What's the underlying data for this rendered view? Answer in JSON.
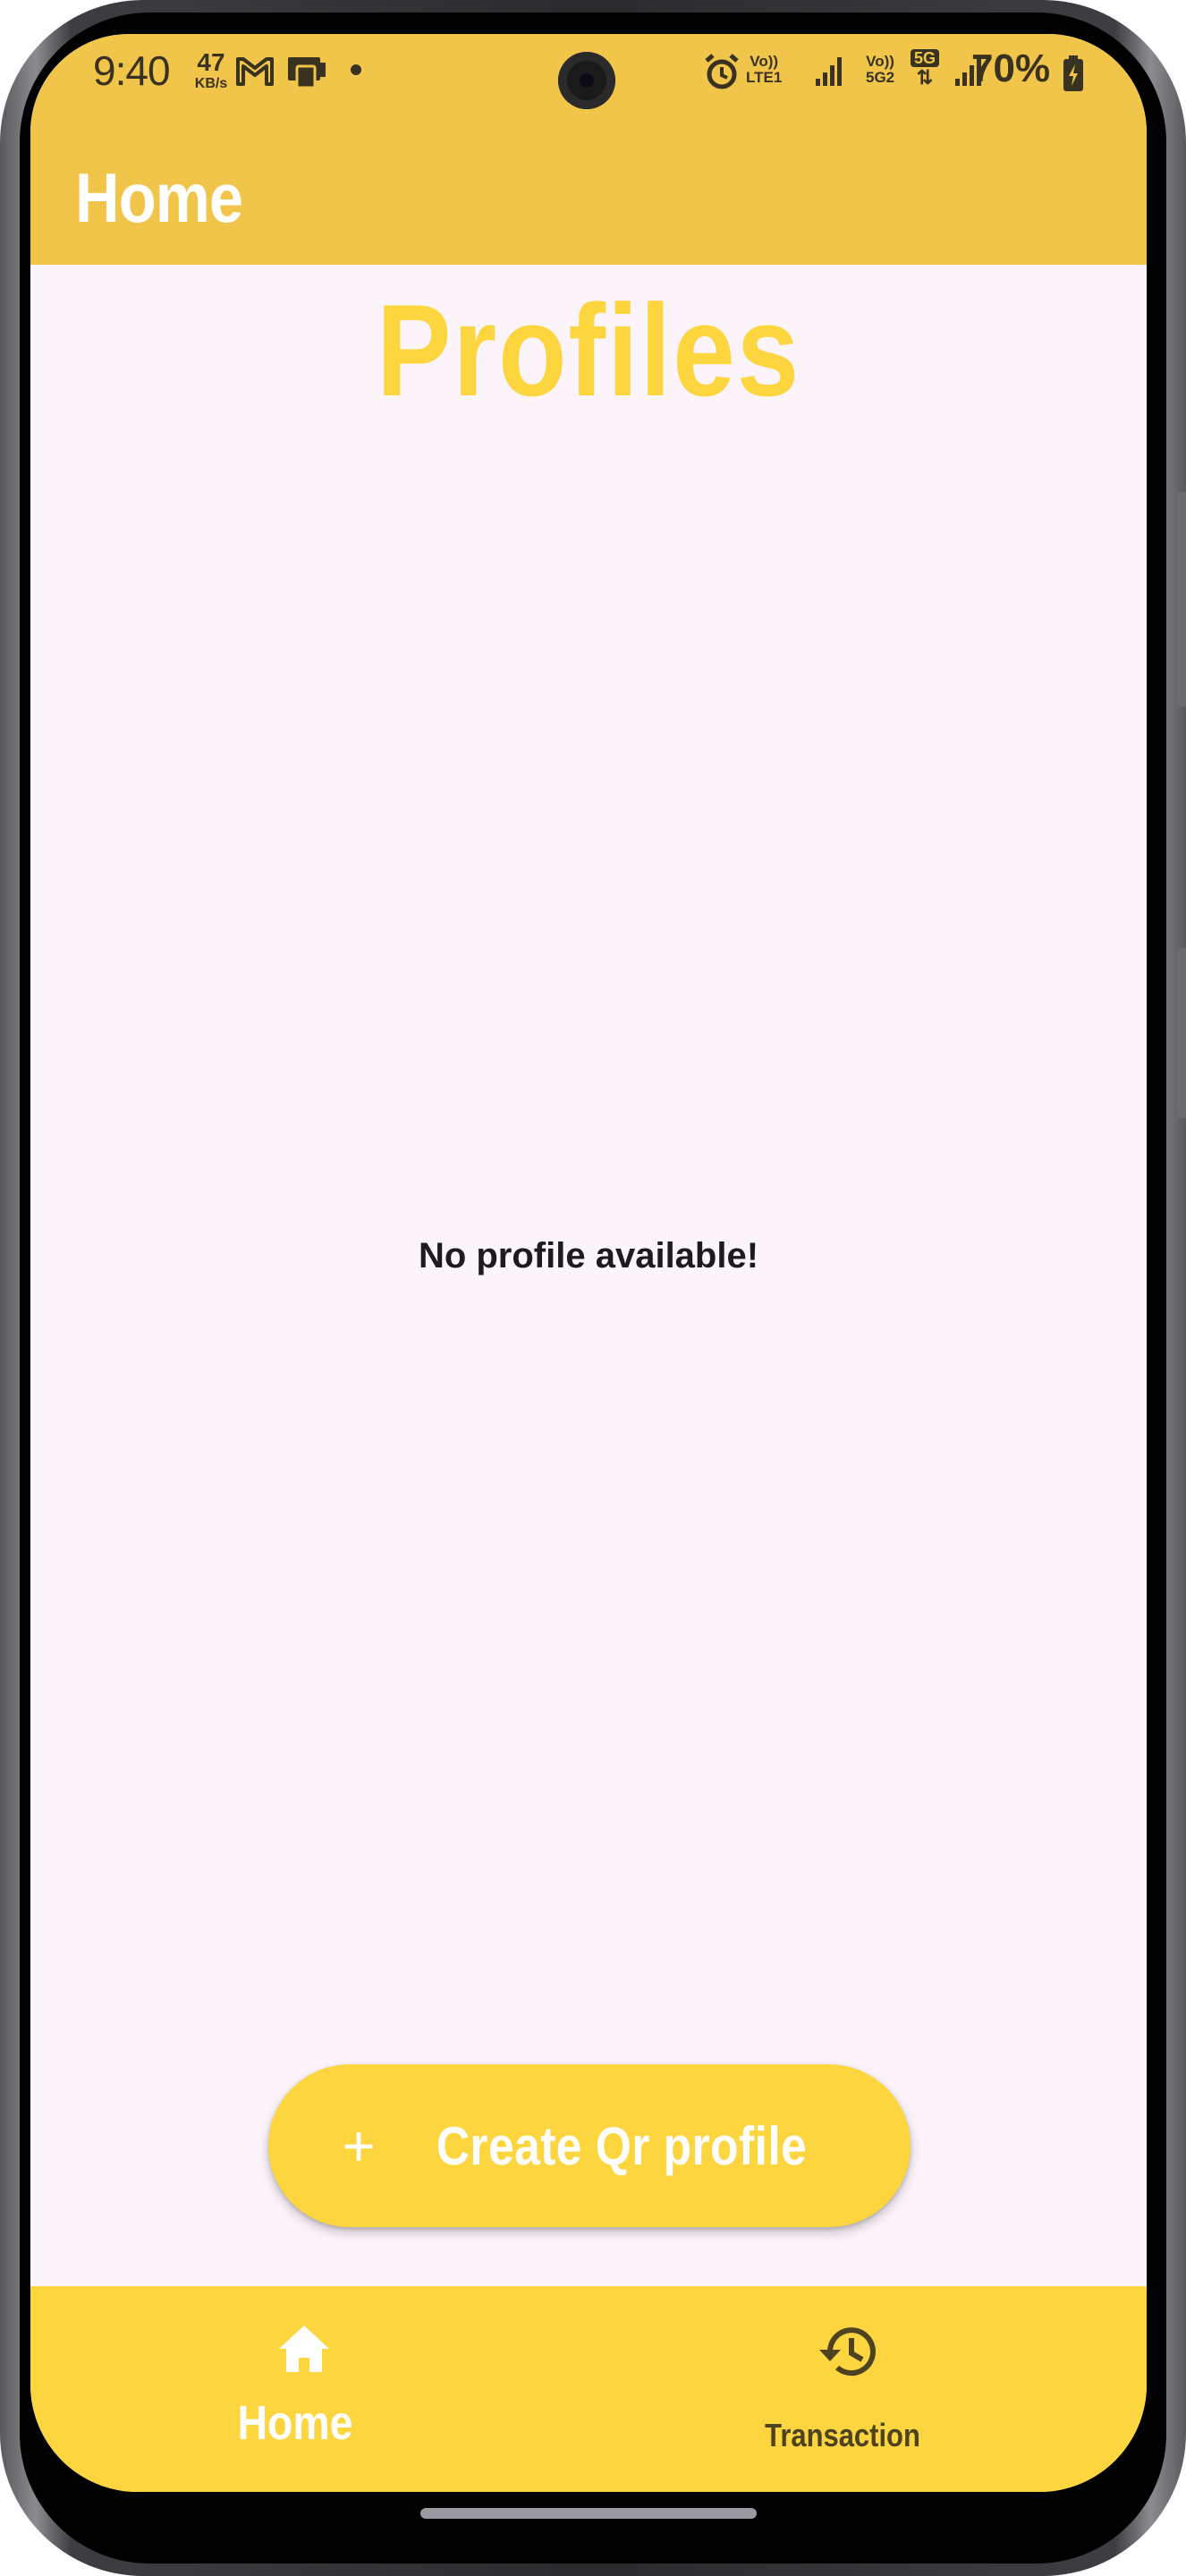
{
  "status_bar": {
    "time": "9:40",
    "net_speed_value": "47",
    "net_speed_unit": "KB/s",
    "sim1_label_top": "Vo))",
    "sim1_label_bottom": "LTE1",
    "sim2_label_top": "Vo))",
    "sim2_label_bottom": "5G2",
    "network_type": "5G",
    "battery": "70%",
    "icons": [
      "gmail-icon",
      "cast-icon",
      "notification-dot",
      "alarm-icon",
      "signal-icon",
      "signal-icon",
      "battery-charging-icon"
    ]
  },
  "app_bar": {
    "title": "Home"
  },
  "main": {
    "title": "Profiles",
    "empty_message": "No profile available!",
    "fab_label": "Create Qr profile",
    "fab_icon": "plus-icon"
  },
  "bottom_nav": {
    "items": [
      {
        "label": "Home",
        "icon": "home-icon",
        "selected": true
      },
      {
        "label": "Transaction",
        "icon": "history-icon",
        "selected": false
      }
    ]
  },
  "colors": {
    "app_bar": "#f0c54a",
    "accent": "#fdd53f",
    "background": "#fcf4fb",
    "text_dark": "#1d1b20"
  }
}
